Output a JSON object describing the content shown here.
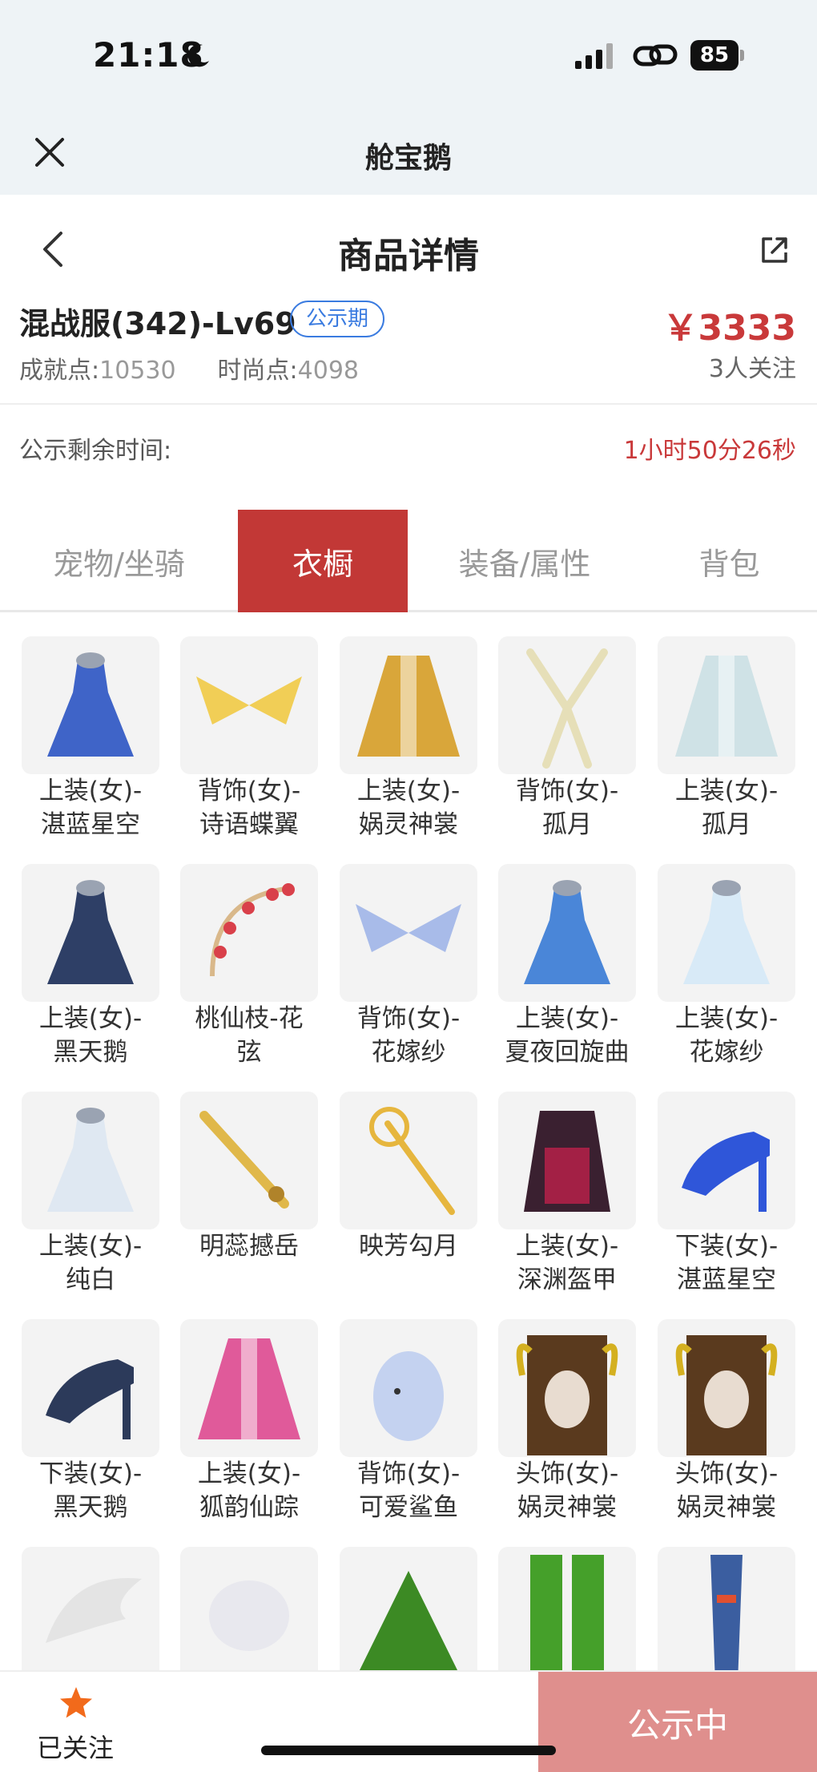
{
  "status_bar": {
    "time": "21:18",
    "battery": "85"
  },
  "app_bar": {
    "title": "舱宝鹅"
  },
  "header": {
    "title": "商品详情"
  },
  "product": {
    "name": "混战服(342)-Lv69",
    "status_tag": "公示期",
    "price": "￥3333",
    "achievement_label": "成就点:",
    "achievement_value": "10530",
    "fashion_label": "时尚点:",
    "fashion_value": "4098",
    "followers": "3人关注"
  },
  "countdown": {
    "label": "公示剩余时间:",
    "value": "1小时50分26秒"
  },
  "tabs": [
    {
      "label": "宠物/坐骑",
      "active": false
    },
    {
      "label": "衣橱",
      "active": true
    },
    {
      "label": "装备/属性",
      "active": false
    },
    {
      "label": "背包",
      "active": false
    }
  ],
  "wardrobe": [
    {
      "line1": "上装(女)-",
      "line2": "湛蓝星空",
      "icon": "blue-dress",
      "color": "#3f64c8"
    },
    {
      "line1": "背饰(女)-",
      "line2": "诗语蝶翼",
      "icon": "yellow-wings",
      "color": "#f0c73a"
    },
    {
      "line1": "上装(女)-",
      "line2": "娲灵神裳",
      "icon": "gold-robe",
      "color": "#d9a63a"
    },
    {
      "line1": "背饰(女)-",
      "line2": "孤月",
      "icon": "ribbon",
      "color": "#e6dfb8"
    },
    {
      "line1": "上装(女)-",
      "line2": "孤月",
      "icon": "pale-robe",
      "color": "#cfe2e6"
    },
    {
      "line1": "上装(女)-",
      "line2": "黑天鹅",
      "icon": "dark-dress",
      "color": "#2e3f66"
    },
    {
      "line1": "桃仙枝-花",
      "line2": "弦",
      "icon": "flower-bow",
      "color": "#d9404a"
    },
    {
      "line1": "背饰(女)-",
      "line2": "花嫁纱",
      "icon": "veil-wings",
      "color": "#9ab0e6"
    },
    {
      "line1": "上装(女)-",
      "line2": "夏夜回旋曲",
      "icon": "blue-gown",
      "color": "#4a86d8"
    },
    {
      "line1": "上装(女)-",
      "line2": "花嫁纱",
      "icon": "white-gown",
      "color": "#d8eaf7"
    },
    {
      "line1": "上装(女)-",
      "line2": "纯白",
      "icon": "white-dress",
      "color": "#dfe8f2"
    },
    {
      "line1": "明蕊撼岳",
      "line2": "",
      "icon": "gold-sword",
      "color": "#e0b84a"
    },
    {
      "line1": "映芳勾月",
      "line2": "",
      "icon": "gold-staff",
      "color": "#e6b63e"
    },
    {
      "line1": "上装(女)-",
      "line2": "深渊盔甲",
      "icon": "red-armor",
      "color": "#a32045"
    },
    {
      "line1": "下装(女)-",
      "line2": "湛蓝星空",
      "icon": "blue-heel",
      "color": "#2f56d9"
    },
    {
      "line1": "下装(女)-",
      "line2": "黑天鹅",
      "icon": "dark-heel",
      "color": "#2c3a5a"
    },
    {
      "line1": "上装(女)-",
      "line2": "狐韵仙踪",
      "icon": "pink-robe",
      "color": "#e05a9a"
    },
    {
      "line1": "背饰(女)-",
      "line2": "可爱鲨鱼",
      "icon": "shark",
      "color": "#c4d2f0"
    },
    {
      "line1": "头饰(女)-",
      "line2": "娲灵神裳",
      "icon": "headdress",
      "color": "#5a3a1e"
    },
    {
      "line1": "头饰(女)-",
      "line2": "娲灵神裳",
      "icon": "headdress",
      "color": "#5a3a1e"
    },
    {
      "line1": "",
      "line2": "",
      "icon": "white-wing",
      "color": "#e4e4e4"
    },
    {
      "line1": "",
      "line2": "",
      "icon": "white-puff",
      "color": "#e8e8ee"
    },
    {
      "line1": "",
      "line2": "",
      "icon": "green-tree",
      "color": "#3c8a24"
    },
    {
      "line1": "",
      "line2": "",
      "icon": "green-legs",
      "color": "#45a02a"
    },
    {
      "line1": "",
      "line2": "",
      "icon": "patterned-legs",
      "color": "#3b5ea0"
    }
  ],
  "bottom": {
    "follow_label": "已关注",
    "action_label": "公示中"
  }
}
